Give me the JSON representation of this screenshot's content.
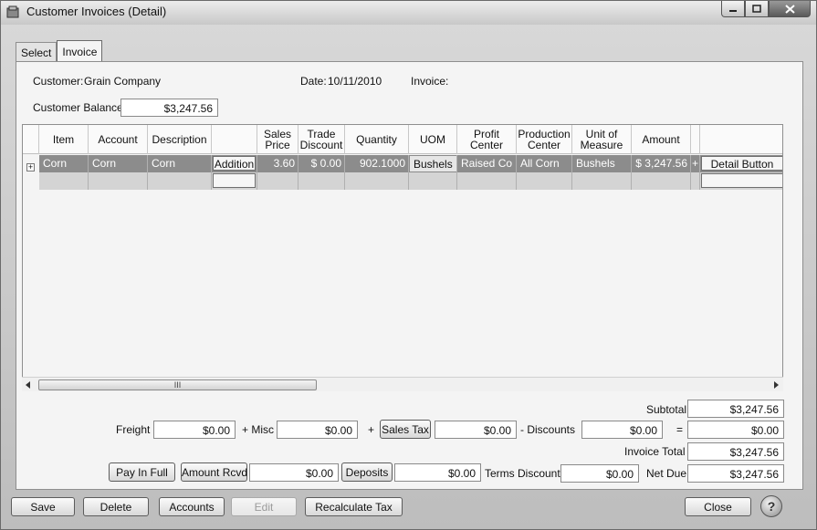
{
  "window": {
    "title": "Customer Invoices (Detail)"
  },
  "tabs": [
    {
      "label": "Select"
    },
    {
      "label": "Invoice"
    }
  ],
  "header": {
    "customer_label": "Customer:",
    "customer_value": "Grain Company",
    "date_label": "Date:",
    "date_value": "10/11/2010",
    "invoice_label": "Invoice:",
    "balance_label": "Customer Balance",
    "balance_value": "$3,247.56"
  },
  "grid": {
    "columns": [
      "Item",
      "Account",
      "Description",
      "",
      "Sales Price",
      "Trade Discount",
      "Quantity",
      "UOM",
      "Profit Center",
      "Production Center",
      "Unit of Measure",
      "Amount",
      ""
    ],
    "rows": [
      {
        "item": "Corn",
        "account": "Corn",
        "description": "Corn",
        "addition": "Addition",
        "sales_price": "3.60",
        "trade_discount": "$ 0.00",
        "quantity": "902.1000",
        "uom": "Bushels",
        "profit_center": "Raised Co",
        "production_center": "All Corn",
        "unit_of_measure": "Bushels",
        "amount": "$ 3,247.56",
        "plus": "+",
        "detail_button": "Detail Button"
      }
    ],
    "scroll_grip": "III",
    "expander": "+"
  },
  "totals": {
    "subtotal_label": "Subtotal",
    "subtotal_value": "$3,247.56",
    "freight_label": "Freight",
    "freight_value": "$0.00",
    "misc_label": "+ Misc",
    "misc_value": "$0.00",
    "plus_label": "+",
    "sales_tax_button": "Sales Tax",
    "sales_tax_value": "$0.00",
    "discounts_label": "-  Discounts",
    "discounts_value": "$0.00",
    "equals_label": "=",
    "equals_value": "$0.00",
    "invoice_total_label": "Invoice Total",
    "invoice_total_value": "$3,247.56",
    "pay_in_full_button": "Pay In Full",
    "amount_rcvd_button": "Amount Rcvd",
    "amount_rcvd_value": "$0.00",
    "deposits_button": "Deposits",
    "deposits_value": "$0.00",
    "terms_discount_label": "Terms Discount",
    "terms_discount_value": "$0.00",
    "net_due_label": "Net Due",
    "net_due_value": "$3,247.56"
  },
  "footer": {
    "save": "Save",
    "delete": "Delete",
    "accounts": "Accounts",
    "edit": "Edit",
    "recalculate_tax": "Recalculate Tax",
    "close": "Close",
    "help": "?"
  }
}
